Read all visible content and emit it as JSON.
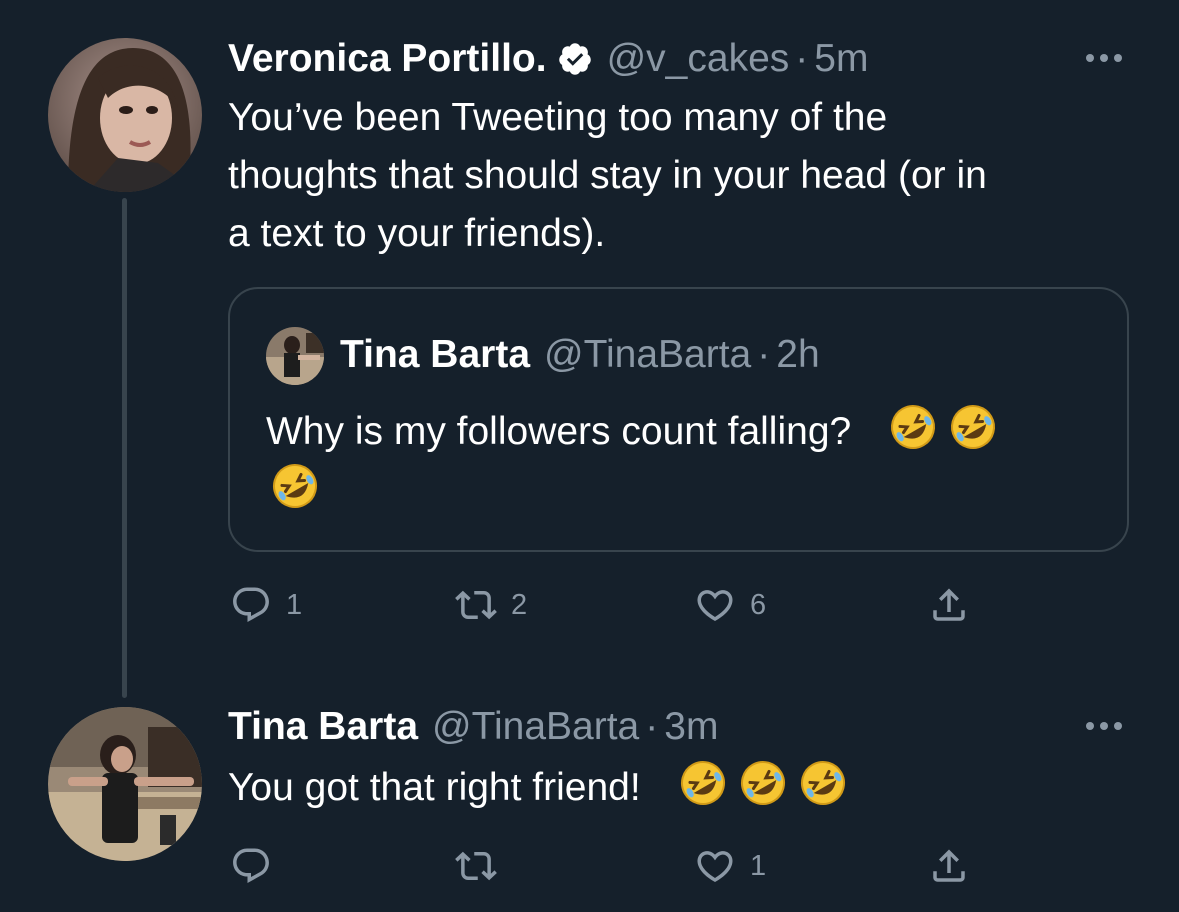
{
  "thread": [
    {
      "display_name": "Veronica Portillo.",
      "verified": true,
      "handle": "@v_cakes",
      "separator": "·",
      "time": "5m",
      "text_lines": [
        "You’ve been Tweeting too many of the",
        "thoughts that should stay in your head (or in",
        "a text to your friends)."
      ],
      "quoted_tweet": {
        "display_name": "Tina Barta",
        "handle": "@TinaBarta",
        "separator": "·",
        "time": "2h",
        "text": "Why is my followers count falling?",
        "emoji": [
          "rolling-on-floor-laughing",
          "rolling-on-floor-laughing",
          "rolling-on-floor-laughing"
        ]
      },
      "actions": {
        "reply_count": "1",
        "retweet_count": "2",
        "like_count": "6"
      }
    },
    {
      "display_name": "Tina Barta",
      "handle": "@TinaBarta",
      "separator": "·",
      "time": "3m",
      "text": "You got that right friend!",
      "emoji": [
        "rolling-on-floor-laughing",
        "rolling-on-floor-laughing",
        "rolling-on-floor-laughing"
      ],
      "actions": {
        "reply_count": "",
        "retweet_count": "",
        "like_count": "1"
      }
    }
  ],
  "colors": {
    "background": "#15202b",
    "text_primary": "#ffffff",
    "text_secondary": "#8b98a5",
    "border": "#38444d"
  },
  "icons": [
    "verified-badge-icon",
    "more-options-icon",
    "reply-icon",
    "retweet-icon",
    "like-icon",
    "share-icon"
  ]
}
